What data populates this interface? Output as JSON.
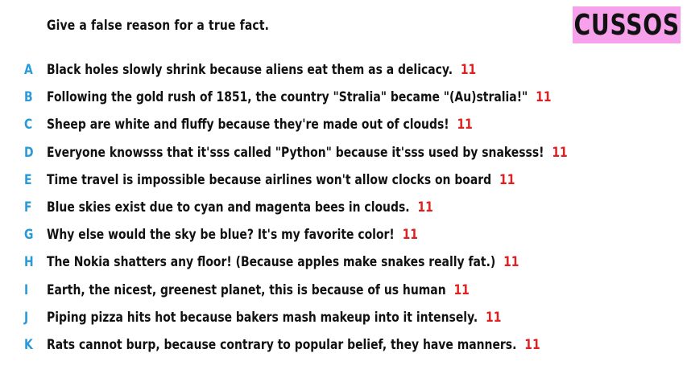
{
  "prompt": "Give a false reason for a true fact.",
  "logo": {
    "text": "CUSSOS",
    "background": "#f7a0ec"
  },
  "colors": {
    "letter": "#2a9bd8",
    "score": "#e02020",
    "text": "#111111"
  },
  "answers": [
    {
      "letter": "A",
      "text": "Black holes slowly shrink because aliens eat them as a delicacy.",
      "score": "11"
    },
    {
      "letter": "B",
      "text": "Following the gold rush of 1851, the country \"Stralia\" became \"(Au)stralia!\"",
      "score": "11"
    },
    {
      "letter": "C",
      "text": "Sheep are white and fluffy because they're made out of clouds!",
      "score": "11"
    },
    {
      "letter": "D",
      "text": "Everyone knowsss that it'sss called \"Python\" because it'sss used by snakesss!",
      "score": "11"
    },
    {
      "letter": "E",
      "text": "Time travel is impossible because airlines won't allow clocks on board",
      "score": "11"
    },
    {
      "letter": "F",
      "text": "Blue skies exist due to cyan and magenta bees in clouds.",
      "score": "11"
    },
    {
      "letter": "G",
      "text": "Why else would the sky be blue? It's my favorite color!",
      "score": "11"
    },
    {
      "letter": "H",
      "text": "The Nokia shatters any floor! (Because apples make snakes really fat.)",
      "score": "11"
    },
    {
      "letter": "I",
      "text": "Earth, the nicest, greenest planet, this is because of us human",
      "score": "11"
    },
    {
      "letter": "J",
      "text": "Piping pizza hits hot because bakers mash makeup into it intensely.",
      "score": "11"
    },
    {
      "letter": "K",
      "text": "Rats cannot burp, because contrary to popular belief, they have manners.",
      "score": "11"
    }
  ]
}
